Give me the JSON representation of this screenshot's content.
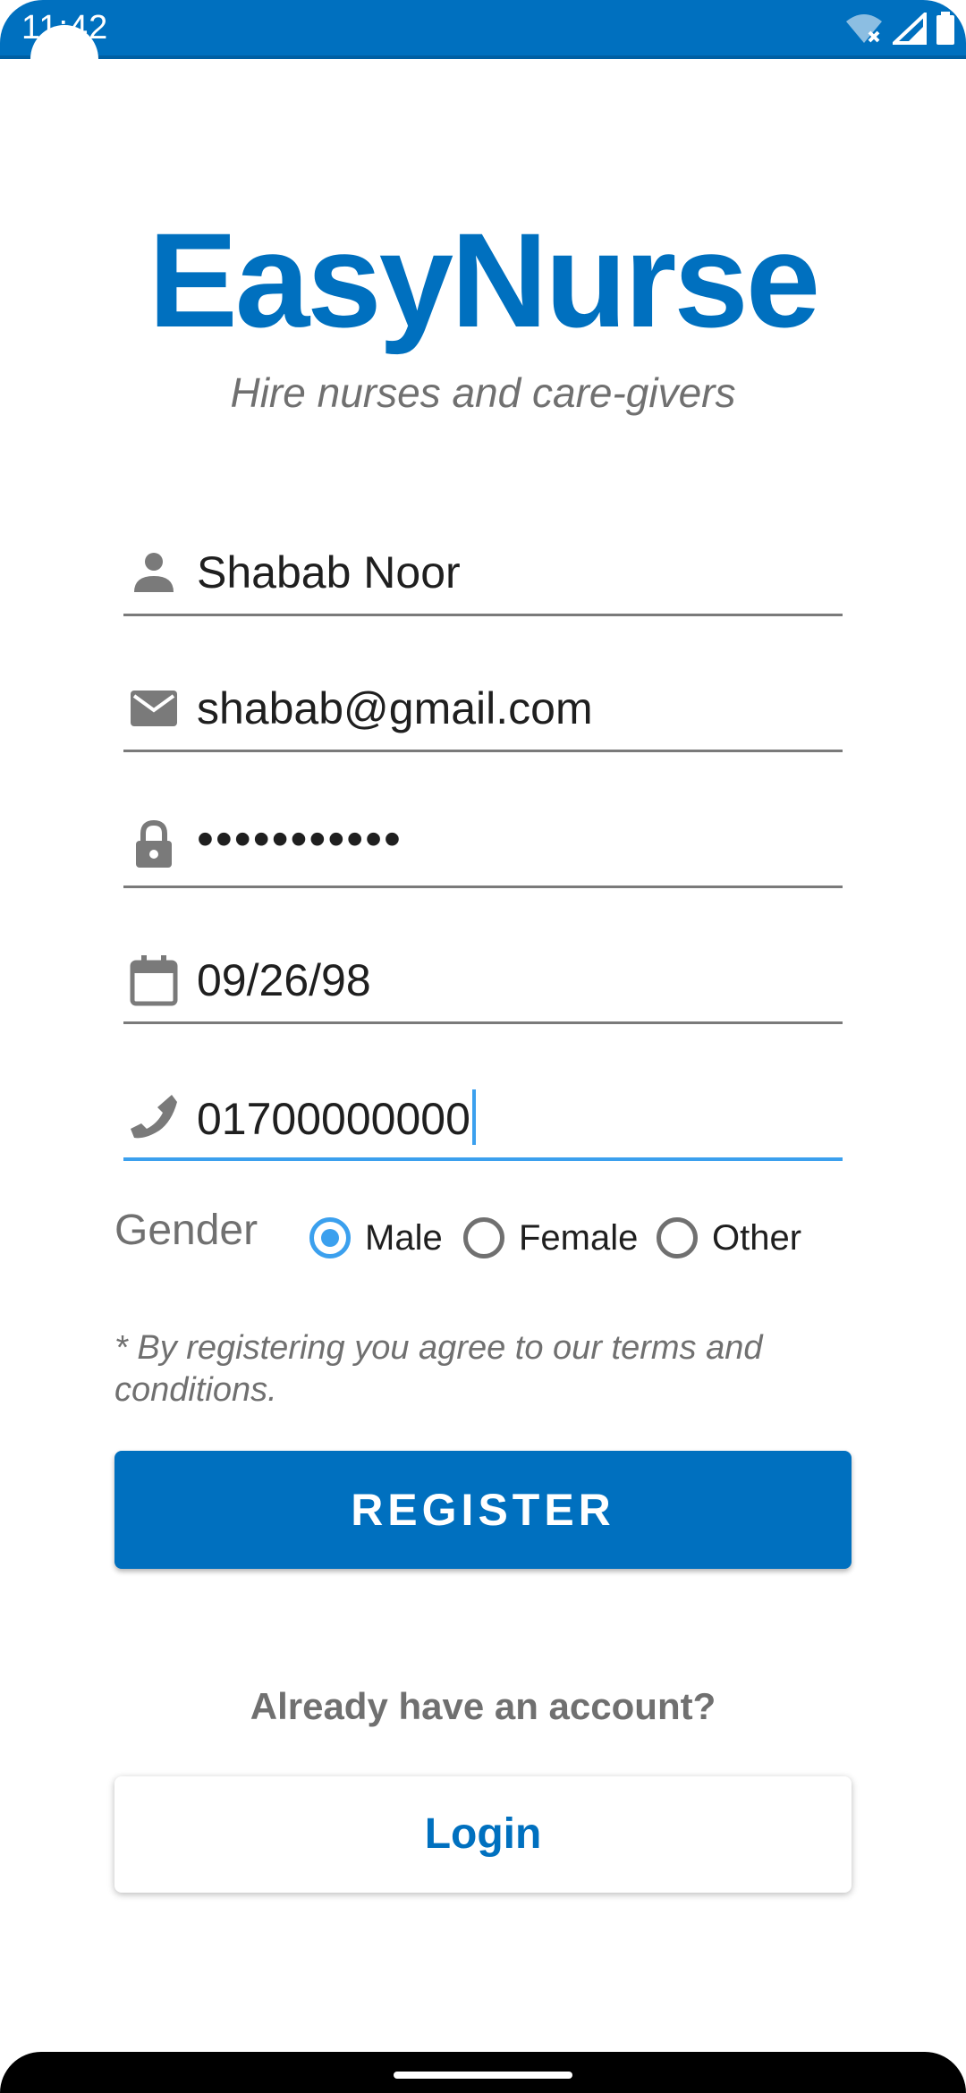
{
  "status_bar": {
    "time": "11:42",
    "icons": [
      "wifi-off-icon",
      "signal-icon",
      "battery-icon"
    ]
  },
  "app": {
    "title": "EasyNurse",
    "tagline": "Hire nurses and care-givers"
  },
  "form": {
    "name": {
      "icon": "person-icon",
      "value": "Shabab Noor"
    },
    "email": {
      "icon": "mail-icon",
      "value": "shabab@gmail.com"
    },
    "password": {
      "icon": "lock-icon",
      "value": "•••••••••••"
    },
    "dob": {
      "icon": "calendar-icon",
      "value": "09/26/98"
    },
    "phone": {
      "icon": "phone-icon",
      "value": "01700000000"
    },
    "gender": {
      "label": "Gender",
      "options": [
        "Male",
        "Female",
        "Other"
      ],
      "selected": "Male"
    },
    "terms": "* By registering you agree to our terms and conditions.",
    "register_label": "REGISTER"
  },
  "login_section": {
    "prompt": "Already have an account?",
    "login_label": "Login"
  },
  "colors": {
    "brand": "#0070bf",
    "accent": "#3ba0ee",
    "muted": "#707070"
  }
}
